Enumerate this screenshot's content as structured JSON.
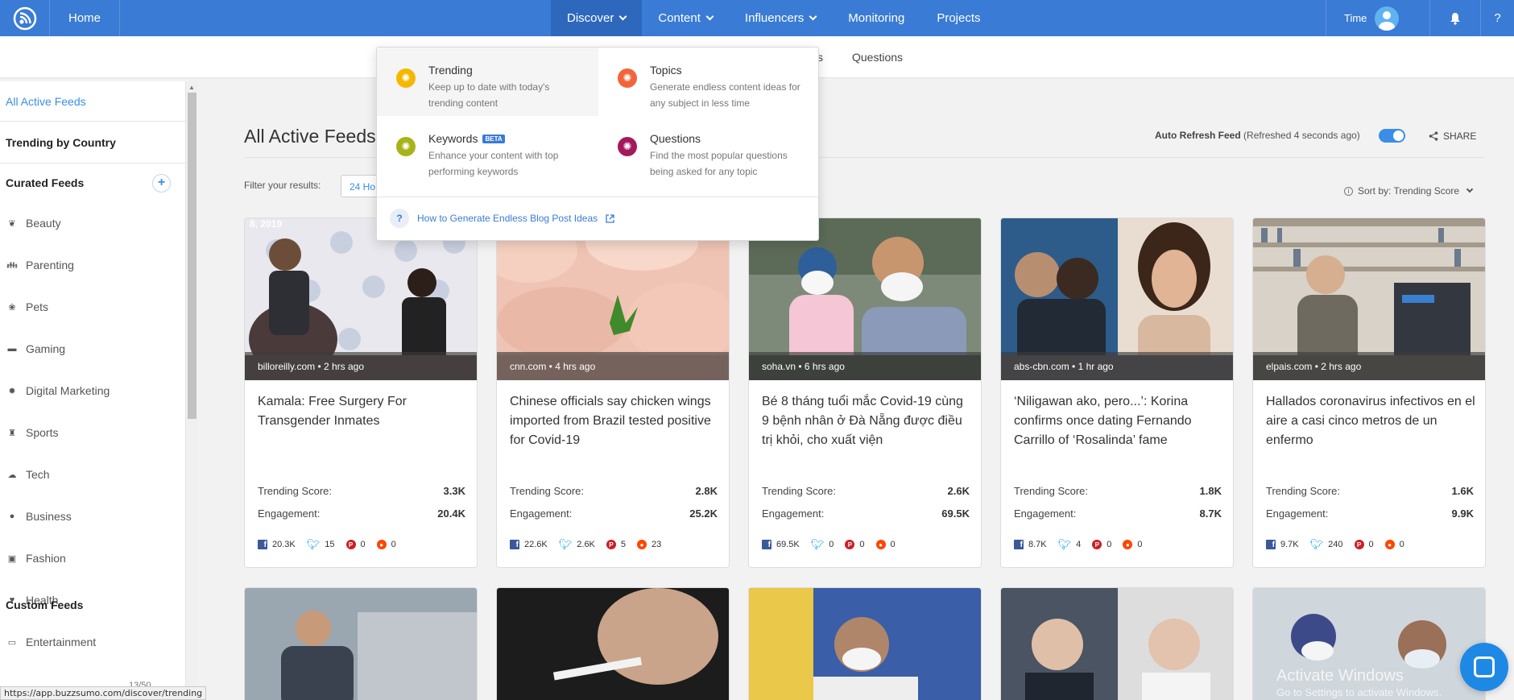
{
  "topnav": {
    "home": "Home",
    "items": [
      {
        "label": "Discover",
        "has_menu": true,
        "active": true
      },
      {
        "label": "Content",
        "has_menu": true
      },
      {
        "label": "Influencers",
        "has_menu": true
      },
      {
        "label": "Monitoring",
        "has_menu": false
      },
      {
        "label": "Projects",
        "has_menu": false
      }
    ],
    "user_name": "Time",
    "help": "?",
    "color": "#3a7bd5"
  },
  "subnav": {
    "partial_label": "s",
    "questions": "Questions"
  },
  "dropdown": {
    "items": [
      {
        "title": "Trending",
        "desc": "Keep up to date with today's trending content",
        "color": "#f5b800",
        "badge": ""
      },
      {
        "title": "Topics",
        "desc": "Generate endless content ideas for any subject in less time",
        "color": "#f2643c",
        "badge": ""
      },
      {
        "title": "Keywords",
        "desc": "Enhance your content with top performing keywords",
        "color": "#a8b31a",
        "badge": "BETA"
      },
      {
        "title": "Questions",
        "desc": "Find the most popular questions being asked for any topic",
        "color": "#a4195e",
        "badge": ""
      }
    ],
    "footer_link": "How to Generate Endless Blog Post Ideas"
  },
  "sidebar": {
    "active": "All Active Feeds",
    "trending_by_country": "Trending by Country",
    "curated_header": "Curated Feeds",
    "items": [
      {
        "label": "Beauty",
        "icon": "beauty-icon"
      },
      {
        "label": "Parenting",
        "icon": "parenting-icon"
      },
      {
        "label": "Pets",
        "icon": "paw-icon"
      },
      {
        "label": "Gaming",
        "icon": "gamepad-icon"
      },
      {
        "label": "Digital Marketing",
        "icon": "gear-icon"
      },
      {
        "label": "Sports",
        "icon": "trophy-icon"
      },
      {
        "label": "Tech",
        "icon": "cloud-icon"
      },
      {
        "label": "Business",
        "icon": "dollar-icon"
      },
      {
        "label": "Fashion",
        "icon": "camera-icon"
      },
      {
        "label": "Health",
        "icon": "heart-icon"
      },
      {
        "label": "Entertainment",
        "icon": "tv-icon"
      }
    ],
    "custom_header": "Custom Feeds",
    "custom_count": "13/50"
  },
  "main": {
    "title": "All Active Feeds",
    "auto_refresh_label": "Auto Refresh Feed",
    "auto_refresh_status": "(Refreshed 4 seconds ago)",
    "share": "SHARE",
    "filter_label": "Filter your results:",
    "filter_value": "24 Ho",
    "sort_by": "Sort by: Trending Score"
  },
  "labels": {
    "trending_score": "Trending Score:",
    "engagement": "Engagement:"
  },
  "cards": [
    {
      "source": "billoreilly.com • 2 hrs ago",
      "title": "Kamala: Free Surgery For Transgender Inmates",
      "trending": "3.3K",
      "engagement": "20.4K",
      "fb": "20.3K",
      "tw": "15",
      "pin": "0",
      "rd": "0",
      "img_caption": "8, 2019"
    },
    {
      "source": "cnn.com • 4 hrs ago",
      "title": "Chinese officials say chicken wings imported from Brazil tested positive for Covid-19",
      "trending": "2.8K",
      "engagement": "25.2K",
      "fb": "22.6K",
      "tw": "2.6K",
      "pin": "5",
      "rd": "23",
      "img_caption": ""
    },
    {
      "source": "soha.vn • 6 hrs ago",
      "title": "Bé 8 tháng tuổi mắc Covid-19 cùng 9 bệnh nhân ở Đà Nẵng được điều trị khỏi, cho xuất viện",
      "trending": "2.6K",
      "engagement": "69.5K",
      "fb": "69.5K",
      "tw": "0",
      "pin": "0",
      "rd": "0",
      "img_caption": ""
    },
    {
      "source": "abs-cbn.com • 1 hr ago",
      "title": "‘Niligawan ako, pero...’: Korina confirms once dating Fernando Carrillo of ‘Rosalinda’ fame",
      "trending": "1.8K",
      "engagement": "8.7K",
      "fb": "8.7K",
      "tw": "4",
      "pin": "0",
      "rd": "0",
      "img_caption": ""
    },
    {
      "source": "elpais.com • 2 hrs ago",
      "title": "Hallados coronavirus infectivos en el aire a casi cinco metros de un enfermo",
      "trending": "1.6K",
      "engagement": "9.9K",
      "fb": "9.7K",
      "tw": "240",
      "pin": "0",
      "rd": "0",
      "img_caption": ""
    }
  ],
  "status_url": "https://app.buzzsumo.com/discover/trending",
  "watermark": {
    "line1": "Activate Windows",
    "line2": "Go to Settings to activate Windows."
  }
}
